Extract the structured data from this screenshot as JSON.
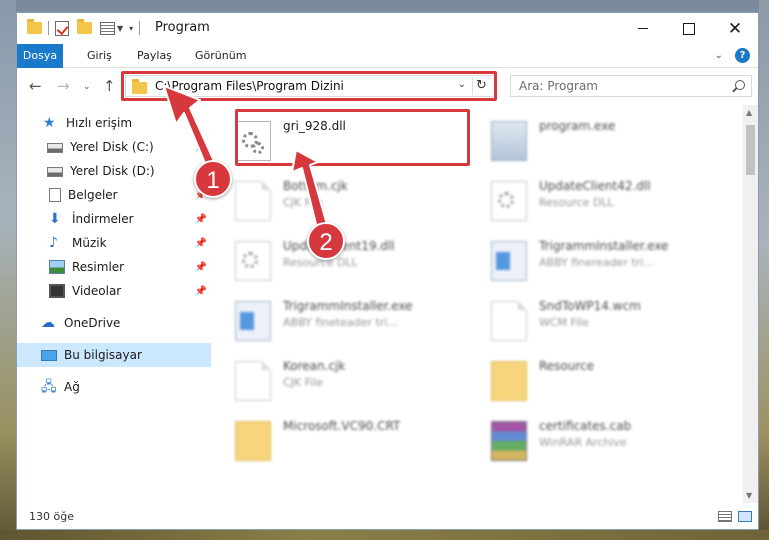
{
  "window": {
    "title": "Program"
  },
  "ribbon": {
    "tabs": [
      "Dosya",
      "Giriş",
      "Paylaş",
      "Görünüm"
    ]
  },
  "address": {
    "path": "C:\\Program Files\\Program Dizini"
  },
  "search": {
    "placeholder": "Ara: Program"
  },
  "sidebar": {
    "items": [
      {
        "label": "Hızlı erişim",
        "icon": "star-icon",
        "pinned": false
      },
      {
        "label": "Yerel Disk (C:)",
        "icon": "disk-icon",
        "pinned": true
      },
      {
        "label": "Yerel Disk (D:)",
        "icon": "disk-icon",
        "pinned": true
      },
      {
        "label": "Belgeler",
        "icon": "document-icon",
        "pinned": true
      },
      {
        "label": "İndirmeler",
        "icon": "download-icon",
        "pinned": true
      },
      {
        "label": "Müzik",
        "icon": "music-icon",
        "pinned": true
      },
      {
        "label": "Resimler",
        "icon": "pictures-icon",
        "pinned": true
      },
      {
        "label": "Videolar",
        "icon": "video-icon",
        "pinned": true
      },
      {
        "label": "OneDrive",
        "icon": "cloud-icon",
        "pinned": false
      },
      {
        "label": "Bu bilgisayar",
        "icon": "computer-icon",
        "pinned": false,
        "selected": true
      },
      {
        "label": "Ağ",
        "icon": "network-icon",
        "pinned": false
      }
    ]
  },
  "files": [
    {
      "name": "gri_928.dll",
      "type": "",
      "icon": "dll-gear-icon",
      "highlighted": true
    },
    {
      "name": "program.exe",
      "type": "",
      "icon": "exe-icon"
    },
    {
      "name": "Bottom.cjk",
      "type": "CJK File",
      "icon": "file-icon"
    },
    {
      "name": "UpdateClient42.dll",
      "type": "Resource DLL",
      "icon": "dll-gear-icon"
    },
    {
      "name": "UpdateClient19.dll",
      "type": "Resource DLL",
      "icon": "dll-gear-icon"
    },
    {
      "name": "TrigrammInstaller.exe",
      "type": "ABBY finereader tri...",
      "icon": "window-icon"
    },
    {
      "name": "TrigrammInstaller.exe",
      "type": "ABBY fineteader tri...",
      "icon": "window-icon"
    },
    {
      "name": "SndToWP14.wcm",
      "type": "WCM File",
      "icon": "file-icon"
    },
    {
      "name": "Korean.cjk",
      "type": "CJK File",
      "icon": "file-icon"
    },
    {
      "name": "Resource",
      "type": "",
      "icon": "folder-icon"
    },
    {
      "name": "Microsoft.VC90.CRT",
      "type": "",
      "icon": "folder-icon"
    },
    {
      "name": "certificates.cab",
      "type": "WinRAR Archive",
      "icon": "archive-icon"
    }
  ],
  "status": {
    "item_count": "130 öğe"
  },
  "annotations": {
    "badge1": "1",
    "badge2": "2",
    "color": "#d6383d"
  }
}
